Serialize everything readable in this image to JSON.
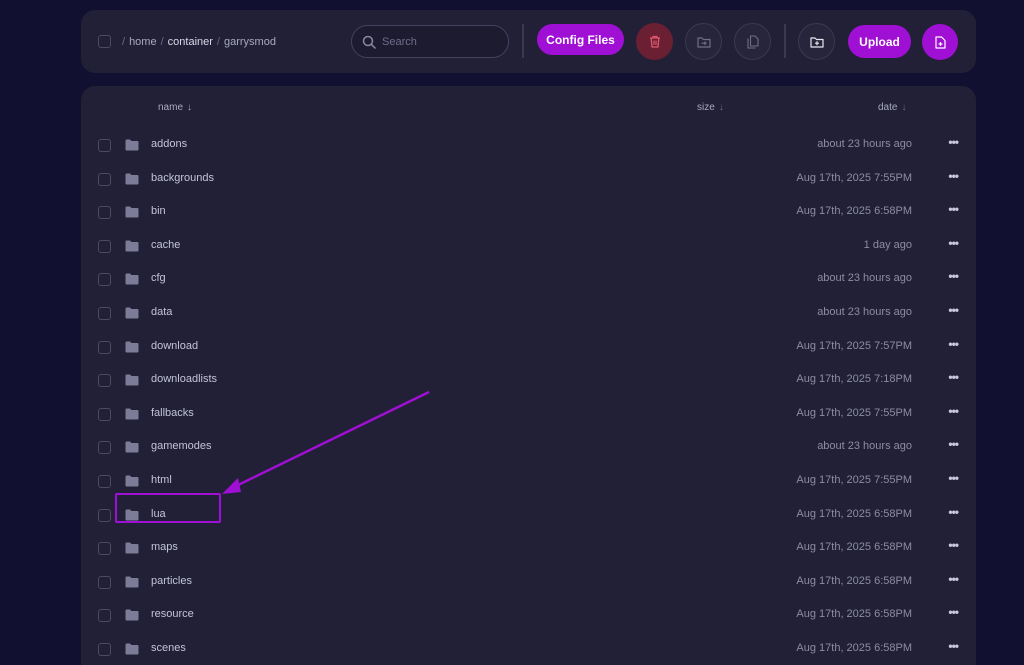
{
  "breadcrumb": {
    "items": [
      "home",
      "container",
      "garrysmod"
    ],
    "separator": "/"
  },
  "search": {
    "placeholder": "Search"
  },
  "toolbar": {
    "config_files_label": "Config Files",
    "upload_label": "Upload"
  },
  "table": {
    "columns": {
      "name": "name",
      "size": "size",
      "date": "date"
    },
    "sort_arrow": "↓",
    "more_glyph": "•••",
    "rows": [
      {
        "name": "addons",
        "date": "about 23 hours ago"
      },
      {
        "name": "backgrounds",
        "date": "Aug 17th, 2025 7:55PM"
      },
      {
        "name": "bin",
        "date": "Aug 17th, 2025 6:58PM"
      },
      {
        "name": "cache",
        "date": "1 day ago"
      },
      {
        "name": "cfg",
        "date": "about 23 hours ago"
      },
      {
        "name": "data",
        "date": "about 23 hours ago"
      },
      {
        "name": "download",
        "date": "Aug 17th, 2025 7:57PM"
      },
      {
        "name": "downloadlists",
        "date": "Aug 17th, 2025 7:18PM"
      },
      {
        "name": "fallbacks",
        "date": "Aug 17th, 2025 7:55PM"
      },
      {
        "name": "gamemodes",
        "date": "about 23 hours ago"
      },
      {
        "name": "html",
        "date": "Aug 17th, 2025 7:55PM"
      },
      {
        "name": "lua",
        "date": "Aug 17th, 2025 6:58PM"
      },
      {
        "name": "maps",
        "date": "Aug 17th, 2025 6:58PM"
      },
      {
        "name": "particles",
        "date": "Aug 17th, 2025 6:58PM"
      },
      {
        "name": "resource",
        "date": "Aug 17th, 2025 6:58PM"
      },
      {
        "name": "scenes",
        "date": "Aug 17th, 2025 6:58PM"
      }
    ]
  },
  "colors": {
    "accent": "#a00fd4",
    "danger": "#6b1f33",
    "panel": "#212036",
    "background": "#111030"
  },
  "icons": [
    "search-icon",
    "trash-icon",
    "move-folder-icon",
    "copy-file-icon",
    "new-folder-icon",
    "new-file-icon",
    "folder-icon",
    "more-icon"
  ]
}
